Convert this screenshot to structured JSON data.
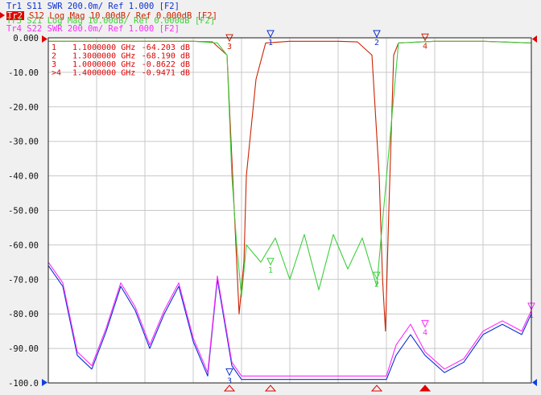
{
  "traces": [
    {
      "id": "Tr1",
      "param": "S11",
      "format": "SWR",
      "scale": "200.0m/",
      "ref": "Ref 1.000",
      "tag": "[F2]",
      "color": "#0b2fd0",
      "active": false
    },
    {
      "id": "Tr2",
      "param": "S12",
      "format": "Log Mag",
      "scale": "10.00dB/",
      "ref": "Ref 0.000dB",
      "tag": "[F2]",
      "color": "#cc2200",
      "active": true
    },
    {
      "id": "Tr3",
      "param": "S21",
      "format": "Log Mag",
      "scale": "10.00dB/",
      "ref": "Ref 0.000dB",
      "tag": "[F2]",
      "color": "#3ecf3e",
      "active": false
    },
    {
      "id": "Tr4",
      "param": "S22",
      "format": "SWR",
      "scale": "200.0m/",
      "ref": "Ref 1.000",
      "tag": "[F2]",
      "color": "#ff28ff",
      "active": false
    }
  ],
  "markers_table": [
    {
      "id": "1",
      "freq": "1.1000000 GHz",
      "value": "-64.203 dB",
      "active": false
    },
    {
      "id": "2",
      "freq": "1.3000000 GHz",
      "value": "-68.190 dB",
      "active": false
    },
    {
      "id": "3",
      "freq": "1.0000000 GHz",
      "value": "-0.8622 dB",
      "active": false
    },
    {
      "id": "4",
      "freq": "1.4000000 GHz",
      "value": "-0.9471 dB",
      "active": true
    }
  ],
  "colors": {
    "grid": "#c8c8c8",
    "border": "#1a1a1a",
    "red_marker": "#e00000",
    "blue_marker": "#0000ee",
    "background": "#f0f0f0"
  },
  "chart_data": {
    "type": "line",
    "x_unit": "GHz",
    "ylim": [
      -100,
      0
    ],
    "yticks": [
      "0.000",
      "-10.00",
      "-20.00",
      "-30.00",
      "-40.00",
      "-50.00",
      "-60.00",
      "-70.00",
      "-80.00",
      "-90.00",
      "-100.0"
    ],
    "x_divisions": 10,
    "grid": true,
    "series": [
      {
        "trace": "Tr2",
        "color": "#cc2200",
        "points": [
          [
            0,
            -1
          ],
          [
            0.5,
            -1
          ],
          [
            1,
            -1
          ],
          [
            2,
            -1
          ],
          [
            3,
            -1
          ],
          [
            3.4,
            -1.2
          ],
          [
            3.7,
            -5
          ],
          [
            3.95,
            -80
          ],
          [
            4.05,
            -65
          ],
          [
            4.1,
            -40
          ],
          [
            4.3,
            -12
          ],
          [
            4.5,
            -1.5
          ],
          [
            5,
            -1
          ],
          [
            6,
            -1
          ],
          [
            6.4,
            -1.2
          ],
          [
            6.7,
            -5
          ],
          [
            6.85,
            -40
          ],
          [
            6.92,
            -70
          ],
          [
            6.98,
            -85
          ],
          [
            7.05,
            -50
          ],
          [
            7.15,
            -5
          ],
          [
            7.25,
            -1.5
          ],
          [
            8,
            -1
          ],
          [
            9,
            -1
          ],
          [
            10,
            -1.5
          ]
        ]
      },
      {
        "trace": "Tr3",
        "color": "#3ecf3e",
        "points": [
          [
            0,
            -1
          ],
          [
            1,
            -1
          ],
          [
            2,
            -1
          ],
          [
            3,
            -1
          ],
          [
            3.5,
            -1.5
          ],
          [
            3.7,
            -5
          ],
          [
            3.8,
            -40
          ],
          [
            3.9,
            -60
          ],
          [
            4,
            -75
          ],
          [
            4.1,
            -60
          ],
          [
            4.4,
            -65
          ],
          [
            4.7,
            -58
          ],
          [
            5,
            -70
          ],
          [
            5.3,
            -57
          ],
          [
            5.6,
            -73
          ],
          [
            5.9,
            -57
          ],
          [
            6.2,
            -67
          ],
          [
            6.5,
            -58
          ],
          [
            6.8,
            -72
          ],
          [
            7.1,
            -25
          ],
          [
            7.25,
            -1.5
          ],
          [
            8,
            -1
          ],
          [
            9,
            -1
          ],
          [
            10,
            -1.5
          ]
        ]
      },
      {
        "trace": "Tr1",
        "color": "#0b2fd0",
        "points": [
          [
            0,
            -66
          ],
          [
            0.3,
            -72
          ],
          [
            0.6,
            -92
          ],
          [
            0.9,
            -96
          ],
          [
            1.2,
            -85
          ],
          [
            1.5,
            -72
          ],
          [
            1.8,
            -79
          ],
          [
            2.1,
            -90
          ],
          [
            2.4,
            -80
          ],
          [
            2.7,
            -72
          ],
          [
            3,
            -88
          ],
          [
            3.3,
            -98
          ],
          [
            3.5,
            -70
          ],
          [
            3.8,
            -95
          ],
          [
            4,
            -99
          ],
          [
            7,
            -99
          ],
          [
            7.2,
            -92
          ],
          [
            7.5,
            -86
          ],
          [
            7.8,
            -92
          ],
          [
            8.2,
            -97
          ],
          [
            8.6,
            -94
          ],
          [
            9,
            -86
          ],
          [
            9.4,
            -83
          ],
          [
            9.8,
            -86
          ],
          [
            10,
            -80
          ]
        ]
      },
      {
        "trace": "Tr4",
        "color": "#ff28ff",
        "points": [
          [
            0,
            -65
          ],
          [
            0.3,
            -71
          ],
          [
            0.6,
            -91
          ],
          [
            0.9,
            -95
          ],
          [
            1.2,
            -84
          ],
          [
            1.5,
            -71
          ],
          [
            1.8,
            -78
          ],
          [
            2.1,
            -89
          ],
          [
            2.4,
            -79
          ],
          [
            2.7,
            -71
          ],
          [
            3,
            -87
          ],
          [
            3.3,
            -97
          ],
          [
            3.5,
            -69
          ],
          [
            3.8,
            -94
          ],
          [
            4,
            -98
          ],
          [
            7,
            -98
          ],
          [
            7.2,
            -89
          ],
          [
            7.5,
            -83
          ],
          [
            7.8,
            -91
          ],
          [
            8.2,
            -96
          ],
          [
            8.6,
            -93
          ],
          [
            9,
            -85
          ],
          [
            9.4,
            -82
          ],
          [
            9.8,
            -85
          ],
          [
            10,
            -79
          ]
        ]
      }
    ],
    "markers": [
      {
        "label": "1",
        "x": 4.6,
        "y": 0,
        "trace": "Tr1"
      },
      {
        "label": "2",
        "x": 6.8,
        "y": 0,
        "trace": "Tr1"
      },
      {
        "label": "3",
        "x": 3.75,
        "y": -1.2,
        "trace": "Tr2"
      },
      {
        "label": "4",
        "x": 7.8,
        "y": -1,
        "trace": "Tr2"
      },
      {
        "label": "1",
        "x": 4.6,
        "y": -66,
        "trace": "Tr3"
      },
      {
        "label": "2",
        "x": 6.8,
        "y": -70,
        "trace": "Tr3"
      },
      {
        "label": "3",
        "x": 3.75,
        "y": -98,
        "trace": "Tr1"
      },
      {
        "label": "4",
        "x": 7.8,
        "y": -84,
        "trace": "Tr4"
      },
      {
        "label": "1",
        "x": 10,
        "y": -79,
        "trace": "Tr4"
      }
    ],
    "bottom_markers": [
      3.75,
      4.6,
      6.8,
      7.8
    ]
  }
}
